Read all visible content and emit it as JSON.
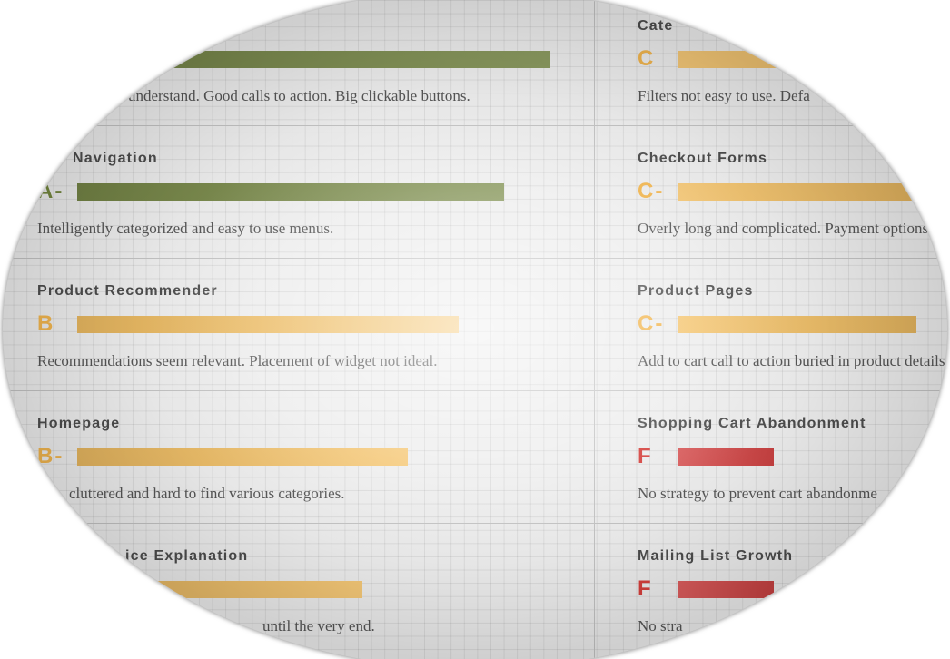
{
  "left": [
    {
      "bar_level": 0.93,
      "bar_color": "#7b8c4a",
      "description": "understand. Good calls to action. Big clickable buttons."
    },
    {
      "title": "Navigation",
      "grade": "A-",
      "grade_color": "#75883f",
      "bar_level": 0.84,
      "bar_color": "#7b8c4a",
      "description": "Intelligently categorized and easy to use menus."
    },
    {
      "title": "Product Recommender",
      "grade": "B",
      "grade_color": "#f2b64f",
      "bar_level": 0.75,
      "bar_color": "#f4c165",
      "description": "Recommendations seem relevant. Placement of widget not ideal."
    },
    {
      "title": "Homepage",
      "grade": "B-",
      "grade_color": "#f2b64f",
      "bar_level": 0.65,
      "bar_color": "#f4c165",
      "description": "cluttered and hard to find various categories."
    },
    {
      "title": "ice Explanation",
      "bar_level": 0.56,
      "bar_color": "#f4c165",
      "description": "until the very end."
    }
  ],
  "right": [
    {
      "title": "Cate",
      "grade": "C",
      "grade_color": "#f2b64f",
      "bar_level": 0.55,
      "bar_color": "#f4c165",
      "description": "Filters not easy to use. Defa"
    },
    {
      "title": "Checkout Forms",
      "grade": "C-",
      "grade_color": "#f2b64f",
      "bar_level": 0.47,
      "bar_color": "#f4c165",
      "description": "Overly long and complicated. Payment options"
    },
    {
      "title": "Product Pages",
      "grade": "C-",
      "grade_color": "#f2b64f",
      "bar_level": 0.47,
      "bar_color": "#f4c165",
      "description": "Add to cart call to action buried in product details"
    },
    {
      "title": "Shopping Cart Abandonment",
      "grade": "F",
      "grade_color": "#d6403c",
      "bar_level": 0.19,
      "bar_color": "#d64646",
      "description": "No strategy to prevent cart abandonme"
    },
    {
      "title": "Mailing List Growth",
      "grade": "F",
      "grade_color": "#d6403c",
      "bar_level": 0.19,
      "bar_color": "#d64646",
      "description": "No stra"
    }
  ]
}
